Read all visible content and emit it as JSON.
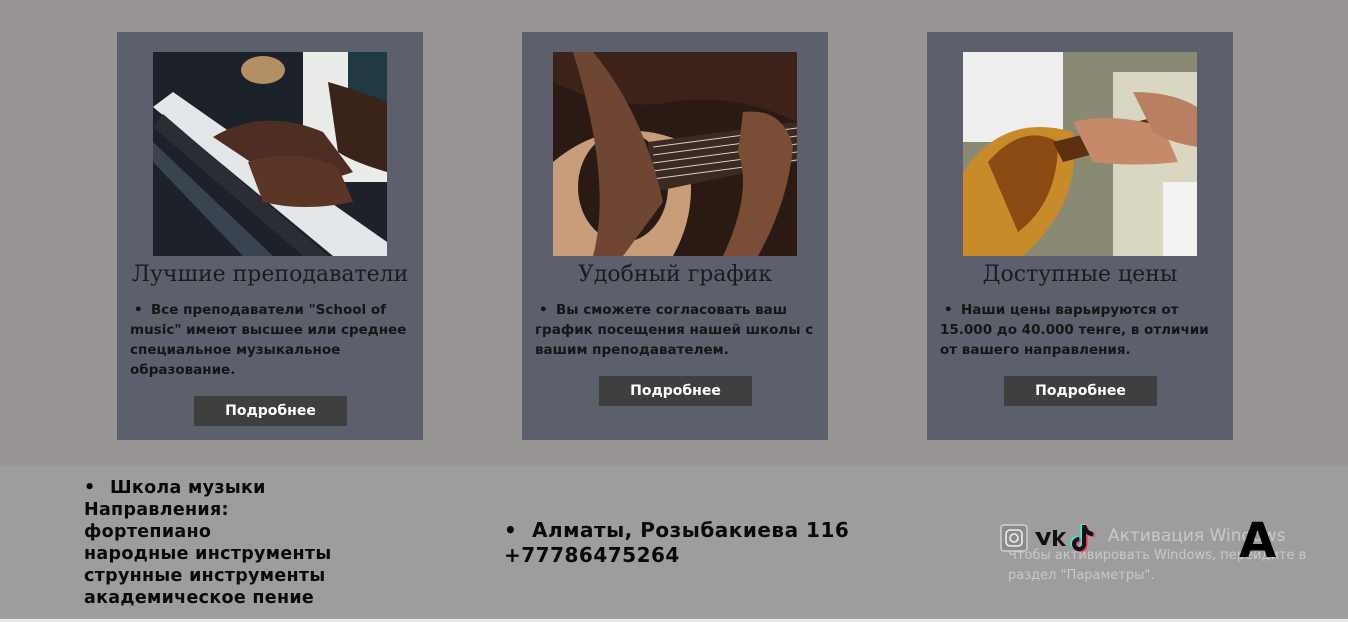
{
  "cards": [
    {
      "title": "Лучшие преподаватели",
      "text": "Все преподаватели \"School of music\" имеют высшее или среднее специальное музыкальное образование.",
      "button": "Подробнее",
      "image": "piano-photo"
    },
    {
      "title": "Удобный график",
      "text": "Вы сможете согласовать ваш график посещения нашей школы с вашим преподавателем.",
      "button": "Подробнее",
      "image": "guitar-photo"
    },
    {
      "title": "Доступные цены",
      "text": "Наши цены варьируются от 15.000 до 40.000 тенге, в отличии от вашего направления.",
      "button": "Подробнее",
      "image": "dombra-photo"
    }
  ],
  "footer": {
    "school": "Школа музыки",
    "directions_label": "Направления:",
    "directions": [
      "фортепиано",
      "народные инструменты",
      "струнные инструменты",
      "академическое пение"
    ],
    "address": "Алматы, Розыбакиева 116",
    "phone": "+77786475264",
    "socials": [
      "instagram-icon",
      "vk-icon",
      "tiktok-icon"
    ],
    "logo_letter": "A"
  },
  "watermark": {
    "title": "Активация Windows",
    "line1": "Чтобы активировать Windows, перейдите в",
    "line2": "раздел \"Параметры\"."
  }
}
